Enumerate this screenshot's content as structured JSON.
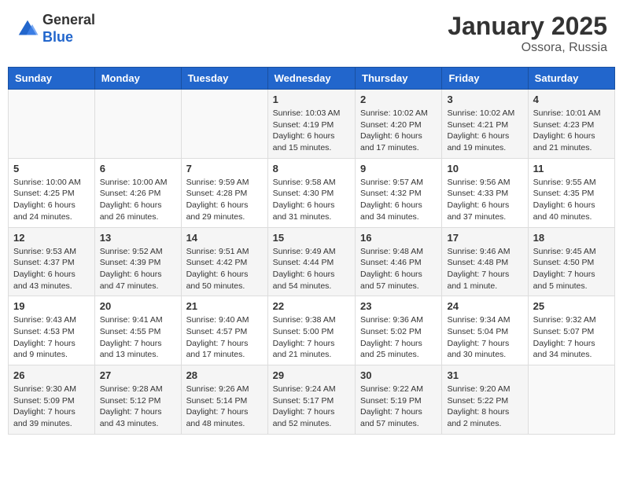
{
  "header": {
    "logo_general": "General",
    "logo_blue": "Blue",
    "month_title": "January 2025",
    "location": "Ossora, Russia"
  },
  "days_of_week": [
    "Sunday",
    "Monday",
    "Tuesday",
    "Wednesday",
    "Thursday",
    "Friday",
    "Saturday"
  ],
  "weeks": [
    [
      {
        "day": "",
        "info": ""
      },
      {
        "day": "",
        "info": ""
      },
      {
        "day": "",
        "info": ""
      },
      {
        "day": "1",
        "info": "Sunrise: 10:03 AM\nSunset: 4:19 PM\nDaylight: 6 hours\nand 15 minutes."
      },
      {
        "day": "2",
        "info": "Sunrise: 10:02 AM\nSunset: 4:20 PM\nDaylight: 6 hours\nand 17 minutes."
      },
      {
        "day": "3",
        "info": "Sunrise: 10:02 AM\nSunset: 4:21 PM\nDaylight: 6 hours\nand 19 minutes."
      },
      {
        "day": "4",
        "info": "Sunrise: 10:01 AM\nSunset: 4:23 PM\nDaylight: 6 hours\nand 21 minutes."
      }
    ],
    [
      {
        "day": "5",
        "info": "Sunrise: 10:00 AM\nSunset: 4:25 PM\nDaylight: 6 hours\nand 24 minutes."
      },
      {
        "day": "6",
        "info": "Sunrise: 10:00 AM\nSunset: 4:26 PM\nDaylight: 6 hours\nand 26 minutes."
      },
      {
        "day": "7",
        "info": "Sunrise: 9:59 AM\nSunset: 4:28 PM\nDaylight: 6 hours\nand 29 minutes."
      },
      {
        "day": "8",
        "info": "Sunrise: 9:58 AM\nSunset: 4:30 PM\nDaylight: 6 hours\nand 31 minutes."
      },
      {
        "day": "9",
        "info": "Sunrise: 9:57 AM\nSunset: 4:32 PM\nDaylight: 6 hours\nand 34 minutes."
      },
      {
        "day": "10",
        "info": "Sunrise: 9:56 AM\nSunset: 4:33 PM\nDaylight: 6 hours\nand 37 minutes."
      },
      {
        "day": "11",
        "info": "Sunrise: 9:55 AM\nSunset: 4:35 PM\nDaylight: 6 hours\nand 40 minutes."
      }
    ],
    [
      {
        "day": "12",
        "info": "Sunrise: 9:53 AM\nSunset: 4:37 PM\nDaylight: 6 hours\nand 43 minutes."
      },
      {
        "day": "13",
        "info": "Sunrise: 9:52 AM\nSunset: 4:39 PM\nDaylight: 6 hours\nand 47 minutes."
      },
      {
        "day": "14",
        "info": "Sunrise: 9:51 AM\nSunset: 4:42 PM\nDaylight: 6 hours\nand 50 minutes."
      },
      {
        "day": "15",
        "info": "Sunrise: 9:49 AM\nSunset: 4:44 PM\nDaylight: 6 hours\nand 54 minutes."
      },
      {
        "day": "16",
        "info": "Sunrise: 9:48 AM\nSunset: 4:46 PM\nDaylight: 6 hours\nand 57 minutes."
      },
      {
        "day": "17",
        "info": "Sunrise: 9:46 AM\nSunset: 4:48 PM\nDaylight: 7 hours\nand 1 minute."
      },
      {
        "day": "18",
        "info": "Sunrise: 9:45 AM\nSunset: 4:50 PM\nDaylight: 7 hours\nand 5 minutes."
      }
    ],
    [
      {
        "day": "19",
        "info": "Sunrise: 9:43 AM\nSunset: 4:53 PM\nDaylight: 7 hours\nand 9 minutes."
      },
      {
        "day": "20",
        "info": "Sunrise: 9:41 AM\nSunset: 4:55 PM\nDaylight: 7 hours\nand 13 minutes."
      },
      {
        "day": "21",
        "info": "Sunrise: 9:40 AM\nSunset: 4:57 PM\nDaylight: 7 hours\nand 17 minutes."
      },
      {
        "day": "22",
        "info": "Sunrise: 9:38 AM\nSunset: 5:00 PM\nDaylight: 7 hours\nand 21 minutes."
      },
      {
        "day": "23",
        "info": "Sunrise: 9:36 AM\nSunset: 5:02 PM\nDaylight: 7 hours\nand 25 minutes."
      },
      {
        "day": "24",
        "info": "Sunrise: 9:34 AM\nSunset: 5:04 PM\nDaylight: 7 hours\nand 30 minutes."
      },
      {
        "day": "25",
        "info": "Sunrise: 9:32 AM\nSunset: 5:07 PM\nDaylight: 7 hours\nand 34 minutes."
      }
    ],
    [
      {
        "day": "26",
        "info": "Sunrise: 9:30 AM\nSunset: 5:09 PM\nDaylight: 7 hours\nand 39 minutes."
      },
      {
        "day": "27",
        "info": "Sunrise: 9:28 AM\nSunset: 5:12 PM\nDaylight: 7 hours\nand 43 minutes."
      },
      {
        "day": "28",
        "info": "Sunrise: 9:26 AM\nSunset: 5:14 PM\nDaylight: 7 hours\nand 48 minutes."
      },
      {
        "day": "29",
        "info": "Sunrise: 9:24 AM\nSunset: 5:17 PM\nDaylight: 7 hours\nand 52 minutes."
      },
      {
        "day": "30",
        "info": "Sunrise: 9:22 AM\nSunset: 5:19 PM\nDaylight: 7 hours\nand 57 minutes."
      },
      {
        "day": "31",
        "info": "Sunrise: 9:20 AM\nSunset: 5:22 PM\nDaylight: 8 hours\nand 2 minutes."
      },
      {
        "day": "",
        "info": ""
      }
    ]
  ]
}
